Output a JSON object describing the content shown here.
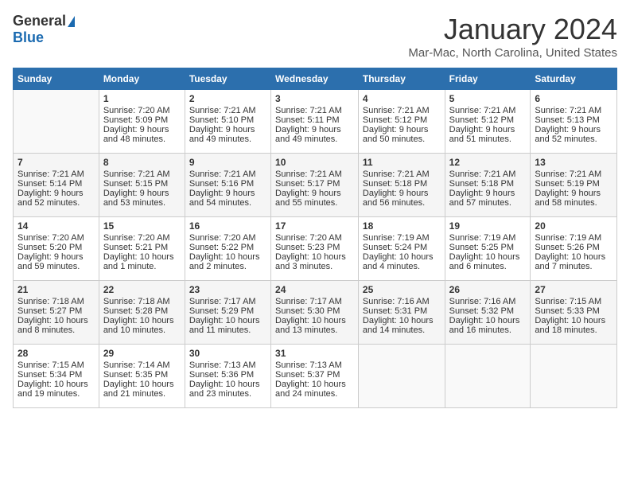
{
  "logo": {
    "general": "General",
    "blue": "Blue"
  },
  "title": "January 2024",
  "subtitle": "Mar-Mac, North Carolina, United States",
  "days": [
    "Sunday",
    "Monday",
    "Tuesday",
    "Wednesday",
    "Thursday",
    "Friday",
    "Saturday"
  ],
  "weeks": [
    [
      {
        "day": "",
        "sunrise": "",
        "sunset": "",
        "daylight": ""
      },
      {
        "day": "1",
        "sunrise": "Sunrise: 7:20 AM",
        "sunset": "Sunset: 5:09 PM",
        "daylight": "Daylight: 9 hours and 48 minutes."
      },
      {
        "day": "2",
        "sunrise": "Sunrise: 7:21 AM",
        "sunset": "Sunset: 5:10 PM",
        "daylight": "Daylight: 9 hours and 49 minutes."
      },
      {
        "day": "3",
        "sunrise": "Sunrise: 7:21 AM",
        "sunset": "Sunset: 5:11 PM",
        "daylight": "Daylight: 9 hours and 49 minutes."
      },
      {
        "day": "4",
        "sunrise": "Sunrise: 7:21 AM",
        "sunset": "Sunset: 5:12 PM",
        "daylight": "Daylight: 9 hours and 50 minutes."
      },
      {
        "day": "5",
        "sunrise": "Sunrise: 7:21 AM",
        "sunset": "Sunset: 5:12 PM",
        "daylight": "Daylight: 9 hours and 51 minutes."
      },
      {
        "day": "6",
        "sunrise": "Sunrise: 7:21 AM",
        "sunset": "Sunset: 5:13 PM",
        "daylight": "Daylight: 9 hours and 52 minutes."
      }
    ],
    [
      {
        "day": "7",
        "sunrise": "Sunrise: 7:21 AM",
        "sunset": "Sunset: 5:14 PM",
        "daylight": "Daylight: 9 hours and 52 minutes."
      },
      {
        "day": "8",
        "sunrise": "Sunrise: 7:21 AM",
        "sunset": "Sunset: 5:15 PM",
        "daylight": "Daylight: 9 hours and 53 minutes."
      },
      {
        "day": "9",
        "sunrise": "Sunrise: 7:21 AM",
        "sunset": "Sunset: 5:16 PM",
        "daylight": "Daylight: 9 hours and 54 minutes."
      },
      {
        "day": "10",
        "sunrise": "Sunrise: 7:21 AM",
        "sunset": "Sunset: 5:17 PM",
        "daylight": "Daylight: 9 hours and 55 minutes."
      },
      {
        "day": "11",
        "sunrise": "Sunrise: 7:21 AM",
        "sunset": "Sunset: 5:18 PM",
        "daylight": "Daylight: 9 hours and 56 minutes."
      },
      {
        "day": "12",
        "sunrise": "Sunrise: 7:21 AM",
        "sunset": "Sunset: 5:18 PM",
        "daylight": "Daylight: 9 hours and 57 minutes."
      },
      {
        "day": "13",
        "sunrise": "Sunrise: 7:21 AM",
        "sunset": "Sunset: 5:19 PM",
        "daylight": "Daylight: 9 hours and 58 minutes."
      }
    ],
    [
      {
        "day": "14",
        "sunrise": "Sunrise: 7:20 AM",
        "sunset": "Sunset: 5:20 PM",
        "daylight": "Daylight: 9 hours and 59 minutes."
      },
      {
        "day": "15",
        "sunrise": "Sunrise: 7:20 AM",
        "sunset": "Sunset: 5:21 PM",
        "daylight": "Daylight: 10 hours and 1 minute."
      },
      {
        "day": "16",
        "sunrise": "Sunrise: 7:20 AM",
        "sunset": "Sunset: 5:22 PM",
        "daylight": "Daylight: 10 hours and 2 minutes."
      },
      {
        "day": "17",
        "sunrise": "Sunrise: 7:20 AM",
        "sunset": "Sunset: 5:23 PM",
        "daylight": "Daylight: 10 hours and 3 minutes."
      },
      {
        "day": "18",
        "sunrise": "Sunrise: 7:19 AM",
        "sunset": "Sunset: 5:24 PM",
        "daylight": "Daylight: 10 hours and 4 minutes."
      },
      {
        "day": "19",
        "sunrise": "Sunrise: 7:19 AM",
        "sunset": "Sunset: 5:25 PM",
        "daylight": "Daylight: 10 hours and 6 minutes."
      },
      {
        "day": "20",
        "sunrise": "Sunrise: 7:19 AM",
        "sunset": "Sunset: 5:26 PM",
        "daylight": "Daylight: 10 hours and 7 minutes."
      }
    ],
    [
      {
        "day": "21",
        "sunrise": "Sunrise: 7:18 AM",
        "sunset": "Sunset: 5:27 PM",
        "daylight": "Daylight: 10 hours and 8 minutes."
      },
      {
        "day": "22",
        "sunrise": "Sunrise: 7:18 AM",
        "sunset": "Sunset: 5:28 PM",
        "daylight": "Daylight: 10 hours and 10 minutes."
      },
      {
        "day": "23",
        "sunrise": "Sunrise: 7:17 AM",
        "sunset": "Sunset: 5:29 PM",
        "daylight": "Daylight: 10 hours and 11 minutes."
      },
      {
        "day": "24",
        "sunrise": "Sunrise: 7:17 AM",
        "sunset": "Sunset: 5:30 PM",
        "daylight": "Daylight: 10 hours and 13 minutes."
      },
      {
        "day": "25",
        "sunrise": "Sunrise: 7:16 AM",
        "sunset": "Sunset: 5:31 PM",
        "daylight": "Daylight: 10 hours and 14 minutes."
      },
      {
        "day": "26",
        "sunrise": "Sunrise: 7:16 AM",
        "sunset": "Sunset: 5:32 PM",
        "daylight": "Daylight: 10 hours and 16 minutes."
      },
      {
        "day": "27",
        "sunrise": "Sunrise: 7:15 AM",
        "sunset": "Sunset: 5:33 PM",
        "daylight": "Daylight: 10 hours and 18 minutes."
      }
    ],
    [
      {
        "day": "28",
        "sunrise": "Sunrise: 7:15 AM",
        "sunset": "Sunset: 5:34 PM",
        "daylight": "Daylight: 10 hours and 19 minutes."
      },
      {
        "day": "29",
        "sunrise": "Sunrise: 7:14 AM",
        "sunset": "Sunset: 5:35 PM",
        "daylight": "Daylight: 10 hours and 21 minutes."
      },
      {
        "day": "30",
        "sunrise": "Sunrise: 7:13 AM",
        "sunset": "Sunset: 5:36 PM",
        "daylight": "Daylight: 10 hours and 23 minutes."
      },
      {
        "day": "31",
        "sunrise": "Sunrise: 7:13 AM",
        "sunset": "Sunset: 5:37 PM",
        "daylight": "Daylight: 10 hours and 24 minutes."
      },
      {
        "day": "",
        "sunrise": "",
        "sunset": "",
        "daylight": ""
      },
      {
        "day": "",
        "sunrise": "",
        "sunset": "",
        "daylight": ""
      },
      {
        "day": "",
        "sunrise": "",
        "sunset": "",
        "daylight": ""
      }
    ]
  ]
}
